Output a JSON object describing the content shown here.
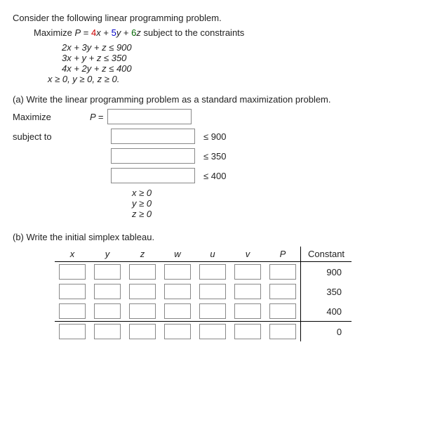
{
  "intro": "Consider the following linear programming problem.",
  "objective": {
    "prefix": "Maximize ",
    "P": "P",
    "eq": " = ",
    "c1": "4",
    "v1": "x",
    "plus1": " + ",
    "c2": "5",
    "v2": "y",
    "plus2": " + ",
    "c3": "6",
    "v3": "z",
    "suffix": " subject to the constraints"
  },
  "constraints": {
    "c1": "2x + 3y + z ≤ 900",
    "c2": "3x +   y + z ≤ 350",
    "c3": "4x + 2y + z ≤ 400",
    "nn": "x ≥ 0, y ≥ 0, z ≥ 0."
  },
  "partA": {
    "prompt": "(a) Write the linear programming problem as a standard maximization problem.",
    "maximize": "Maximize",
    "P_eq": "P =",
    "subject": "subject to",
    "rhs1": "≤ 900",
    "rhs2": "≤ 350",
    "rhs3": "≤ 400",
    "nn1": "x ≥ 0",
    "nn2": "y ≥ 0",
    "nn3": "z ≥ 0"
  },
  "partB": {
    "prompt": "(b) Write the initial simplex tableau.",
    "headers": {
      "x": "x",
      "y": "y",
      "z": "z",
      "w": "w",
      "u": "u",
      "v": "v",
      "P": "P",
      "const": "Constant"
    },
    "consts": {
      "r1": "900",
      "r2": "350",
      "r3": "400",
      "r4": "0"
    }
  },
  "chart_data": {
    "type": "table",
    "title": "Initial simplex tableau (blank entries to fill)",
    "columns": [
      "x",
      "y",
      "z",
      "w",
      "u",
      "v",
      "P",
      "Constant"
    ],
    "rows": [
      [
        null,
        null,
        null,
        null,
        null,
        null,
        null,
        900
      ],
      [
        null,
        null,
        null,
        null,
        null,
        null,
        null,
        350
      ],
      [
        null,
        null,
        null,
        null,
        null,
        null,
        null,
        400
      ],
      [
        null,
        null,
        null,
        null,
        null,
        null,
        null,
        0
      ]
    ]
  }
}
